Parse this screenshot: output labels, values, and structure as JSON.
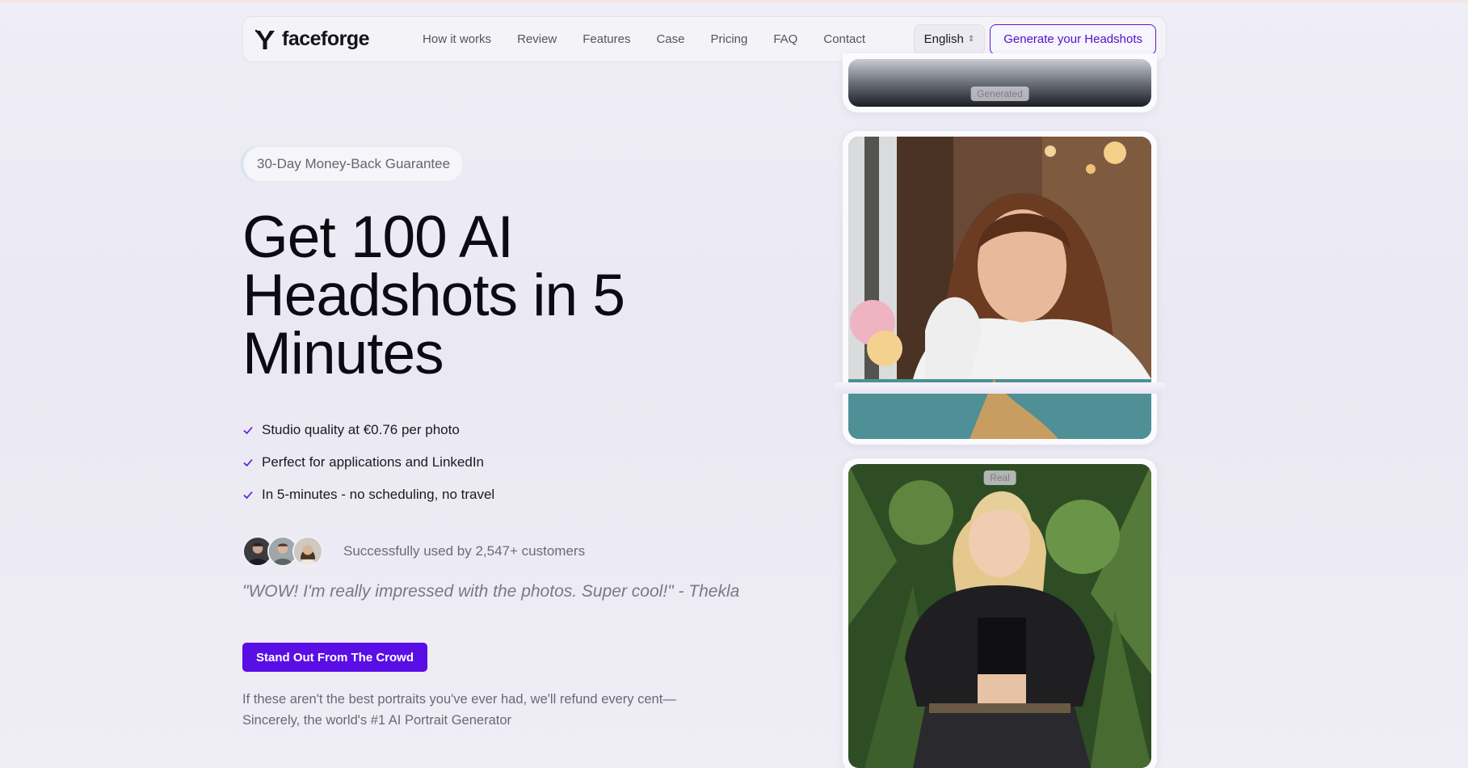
{
  "brand": {
    "name": "faceforge"
  },
  "nav": {
    "links": [
      "How it works",
      "Review",
      "Features",
      "Case",
      "Pricing",
      "FAQ",
      "Contact"
    ],
    "language": "English",
    "cta": "Generate your Headshots"
  },
  "hero": {
    "badge": "30-Day Money-Back Guarantee",
    "headline": "Get 100 AI Headshots in 5 Minutes",
    "benefits": [
      "Studio quality at €0.76 per photo",
      "Perfect for applications and LinkedIn",
      "In 5-minutes - no scheduling, no travel"
    ],
    "social_proof": "Successfully used by 2,547+ customers",
    "quote": "\"WOW! I'm really impressed with the photos. Super cool!\" - Thekla",
    "cta": "Stand Out From The Crowd",
    "refund_note": "If these aren't the best portraits you've ever had, we'll refund every cent— Sincerely, the world's #1 AI Portrait Generator"
  },
  "gallery": {
    "top_tag": "Generated",
    "bottom_tag": "Real"
  },
  "colors": {
    "accent": "#5a0ee6",
    "accent_text": "#4f12c9",
    "background": "#ece9f3"
  },
  "icons": [
    "logo-mark-icon",
    "check-icon",
    "chevron-updown-icon"
  ]
}
